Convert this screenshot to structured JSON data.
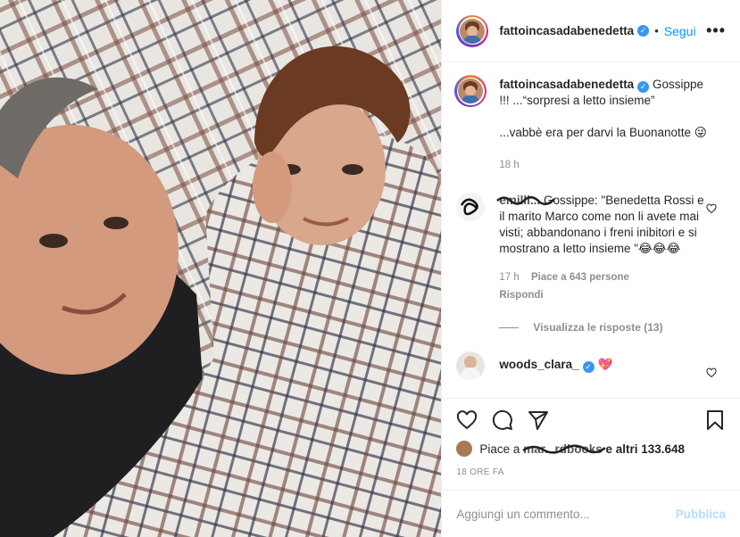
{
  "header": {
    "username": "fattoincasadabenedetta",
    "verified_badge": "✓",
    "separator": "•",
    "follow_label": "Segui",
    "more_label": "•••"
  },
  "caption": {
    "username": "fattoincasadabenedetta",
    "text_line1": "Gossippe !!! ...“sorpresi a letto insieme”",
    "text_line2": "...vabbè era per darvi la Buonanotte 😜",
    "time": "18 h"
  },
  "comments": [
    {
      "username_scribbled": "emilli...",
      "text": "Gossippe: \"Benedetta Rossi e il marito Marco come non li avete mai visti; abbandonano i freni inibitori e si mostrano a letto insieme \"😂😂😂",
      "time": "17 h",
      "likes": "Piace a 643 persone",
      "reply_label": "Rispondi",
      "view_replies": "Visualizza le risposte (13)"
    },
    {
      "username": "woods_clara_",
      "text": "💖"
    }
  ],
  "actions": {
    "like_icon": "heart-icon",
    "comment_icon": "comment-icon",
    "share_icon": "share-icon",
    "save_icon": "bookmark-icon"
  },
  "likes_line": {
    "prefix": "Piace a",
    "scribbled_user": "mar...rdbooks",
    "suffix": "e altri 133.648"
  },
  "timestamp": "18 ORE FA",
  "add_comment": {
    "placeholder": "Aggiungi un commento...",
    "publish_label": "Pubblica"
  },
  "colors": {
    "link_blue": "#0095f6",
    "publish_disabled": "#b2dffc",
    "verified_blue": "#3897f0",
    "muted": "#8e8e8e"
  }
}
